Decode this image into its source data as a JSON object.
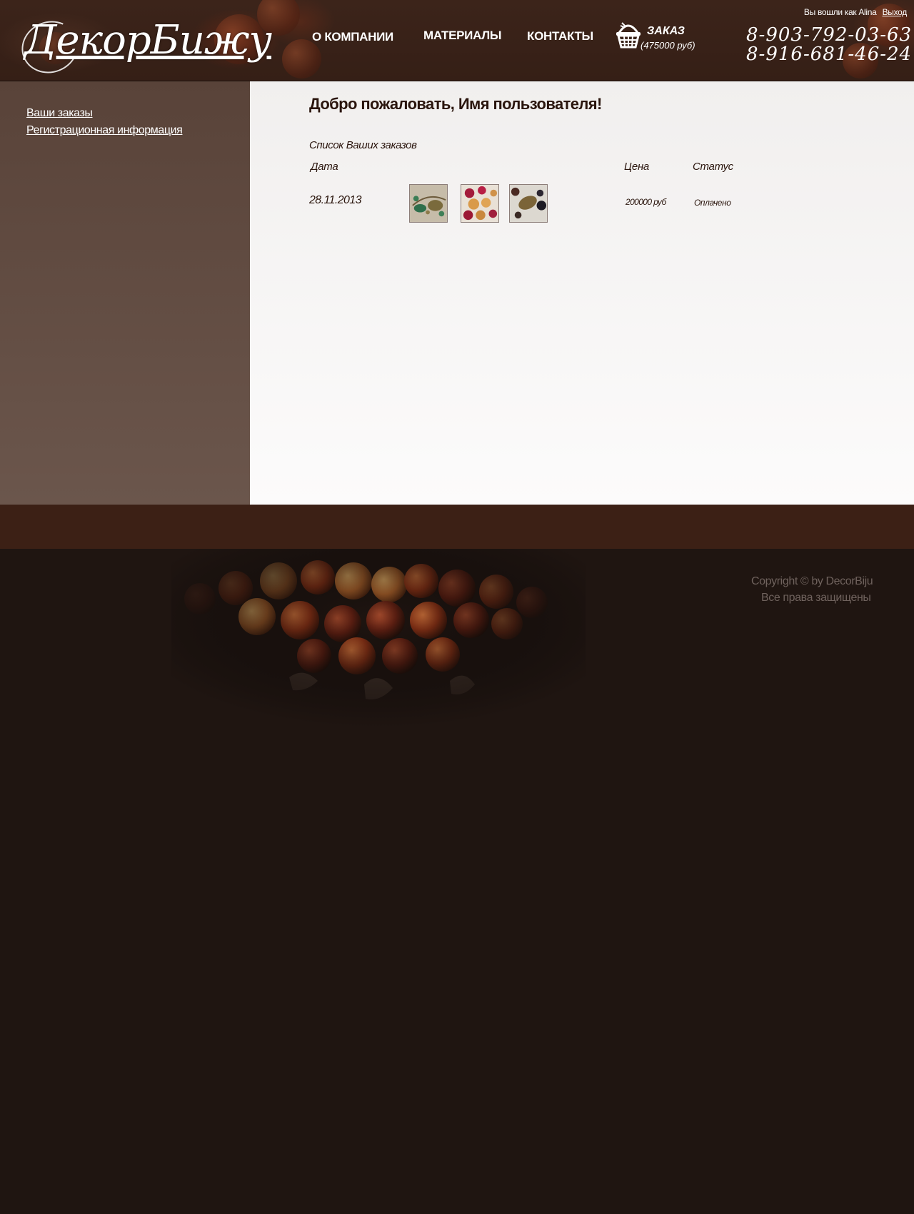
{
  "header": {
    "logo_text": "ДекорБижу",
    "nav": {
      "about": "О КОМПАНИИ",
      "materials": "МАТЕРИАЛЫ",
      "contacts": "КОНТАКТЫ"
    },
    "cart": {
      "title": "ЗАКАЗ",
      "total": "(475000 руб)",
      "icon": "basket-icon"
    },
    "phones": [
      "8-903-792-03-63",
      "8-916-681-46-24"
    ],
    "user": {
      "status_text": "Вы вошли как Alina",
      "logout_label": "Выход"
    }
  },
  "sidebar": {
    "items": [
      {
        "label": "Ваши заказы"
      },
      {
        "label": "Регистрационная информация"
      }
    ]
  },
  "main": {
    "welcome": "Добро пожаловать, Имя пользователя!",
    "orders_title": "Список Ваших заказов",
    "columns": {
      "date": "Дата",
      "price": "Цена",
      "status": "Статус"
    },
    "orders": [
      {
        "date": "28.11.2013",
        "thumbnails": [
          "bracelet-green-thumbnail",
          "beads-red-orange-thumbnail",
          "beads-dark-thumbnail"
        ],
        "price": "200000 руб",
        "status": "Оплачено"
      }
    ]
  },
  "footer": {
    "copyright": "Copyright © by DecorBiju",
    "rights": "Все права защищены"
  },
  "colors": {
    "header_bg": "#3c241a",
    "sidebar_bg": "#6b564c",
    "main_bg": "#f1efee",
    "footer_band": "#3c2015",
    "footer_bg": "#1f1511",
    "text_dark": "#2a150d",
    "footer_text": "#6f625d"
  }
}
